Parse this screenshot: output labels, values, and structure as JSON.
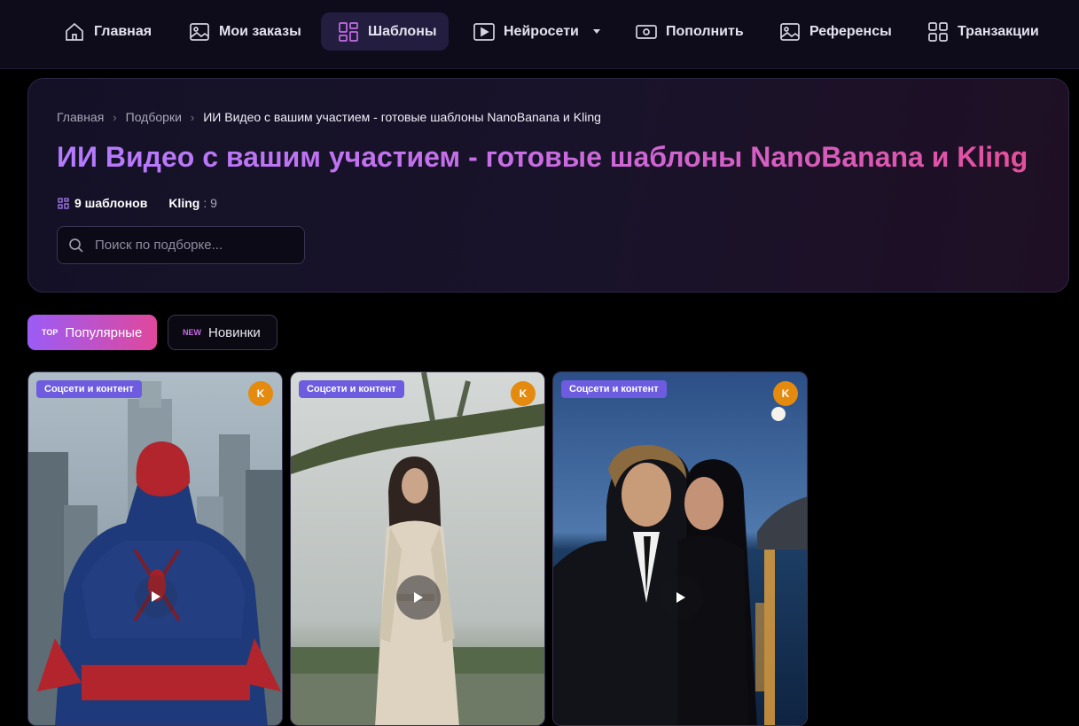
{
  "nav": {
    "items": [
      {
        "label": "Главная",
        "icon": "home-icon"
      },
      {
        "label": "Мои заказы",
        "icon": "image-icon"
      },
      {
        "label": "Шаблоны",
        "icon": "grid-icon",
        "active": true
      },
      {
        "label": "Нейросети",
        "icon": "video-icon",
        "dropdown": true
      },
      {
        "label": "Пополнить",
        "icon": "wallet-icon"
      },
      {
        "label": "Референсы",
        "icon": "image-icon"
      },
      {
        "label": "Транзакции",
        "icon": "grid-icon"
      }
    ]
  },
  "breadcrumb": [
    "Главная",
    "Подборки",
    "ИИ Видео с вашим участием - готовые шаблоны NanoBanana и Kling"
  ],
  "title": "ИИ Видео с вашим участием - готовые шаблоны NanoBanana и Kling",
  "meta": {
    "templates_count": "9 шаблонов",
    "model_name": "Kling",
    "model_count": ": 9"
  },
  "search": {
    "placeholder": "Поиск по подборке..."
  },
  "filters": [
    {
      "tag": "TOP",
      "label": "Популярные",
      "active": true
    },
    {
      "tag": "NEW",
      "label": "Новинки",
      "active": false
    }
  ],
  "cards": [
    {
      "category": "Соцсети и контент",
      "model_badge": "K"
    },
    {
      "category": "Соцсети и контент",
      "model_badge": "K"
    },
    {
      "category": "Соцсети и контент",
      "model_badge": "K"
    }
  ],
  "colors": {
    "nav_bg": "#0e0c1b",
    "active_tab": "#231d3f",
    "title_gradient_start": "#b57bff",
    "title_gradient_end": "#e34f9c",
    "category_badge": "#6d5cdf",
    "model_badge": "#e48a0f"
  }
}
